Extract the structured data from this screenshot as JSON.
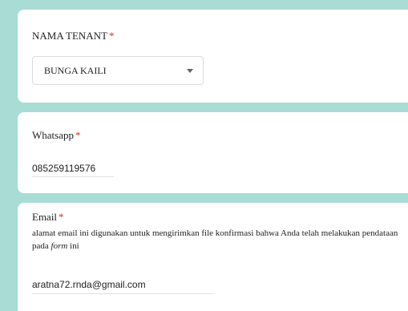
{
  "questions": {
    "tenant": {
      "title": "NAMA TENANT",
      "required_mark": "*",
      "selected_value": "BUNGA KAILI"
    },
    "whatsapp": {
      "title": "Whatsapp",
      "required_mark": "*",
      "answer": "085259119576"
    },
    "email": {
      "title": "Email",
      "required_mark": "*",
      "description_prefix": "alamat email ini digunakan untuk mengirimkan file konfirmasi bahwa Anda telah melakukan pendataan pada ",
      "description_emphasis": "form",
      "description_suffix": " ini",
      "answer": "aratna72.rnda@gmail.com"
    }
  },
  "colors": {
    "background": "#a8dcd5",
    "card": "#ffffff",
    "required": "#d93025"
  },
  "icons": {
    "dropdown": "chevron-down-icon"
  }
}
